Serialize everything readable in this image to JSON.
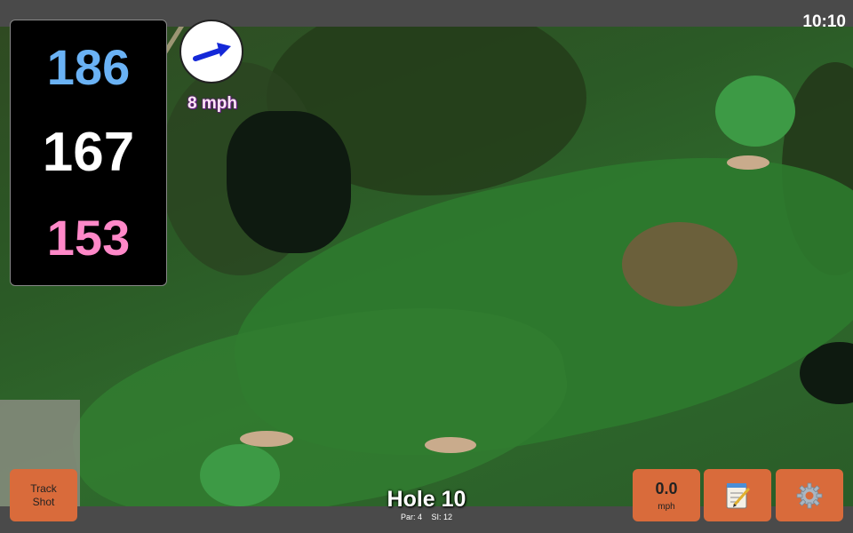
{
  "status": {
    "time": "10:10"
  },
  "distances": {
    "back": "186",
    "middle": "167",
    "front": "153"
  },
  "wind": {
    "speed": "8 mph",
    "icon": "wind-arrow-icon"
  },
  "buttons": {
    "track_shot": "Track Shot",
    "speed_value": "0.0",
    "speed_unit": "mph",
    "notes_icon": "notepad-icon",
    "settings_icon": "gear-icon"
  },
  "hole": {
    "title": "Hole 10",
    "par": "Par: 4",
    "si": "SI: 12"
  },
  "colors": {
    "back_distance": "#6ab2f5",
    "middle_distance": "#ffffff",
    "front_distance": "#ff88c8",
    "button_bg": "#d96b3b",
    "bar_bg": "#4a4a4a"
  }
}
